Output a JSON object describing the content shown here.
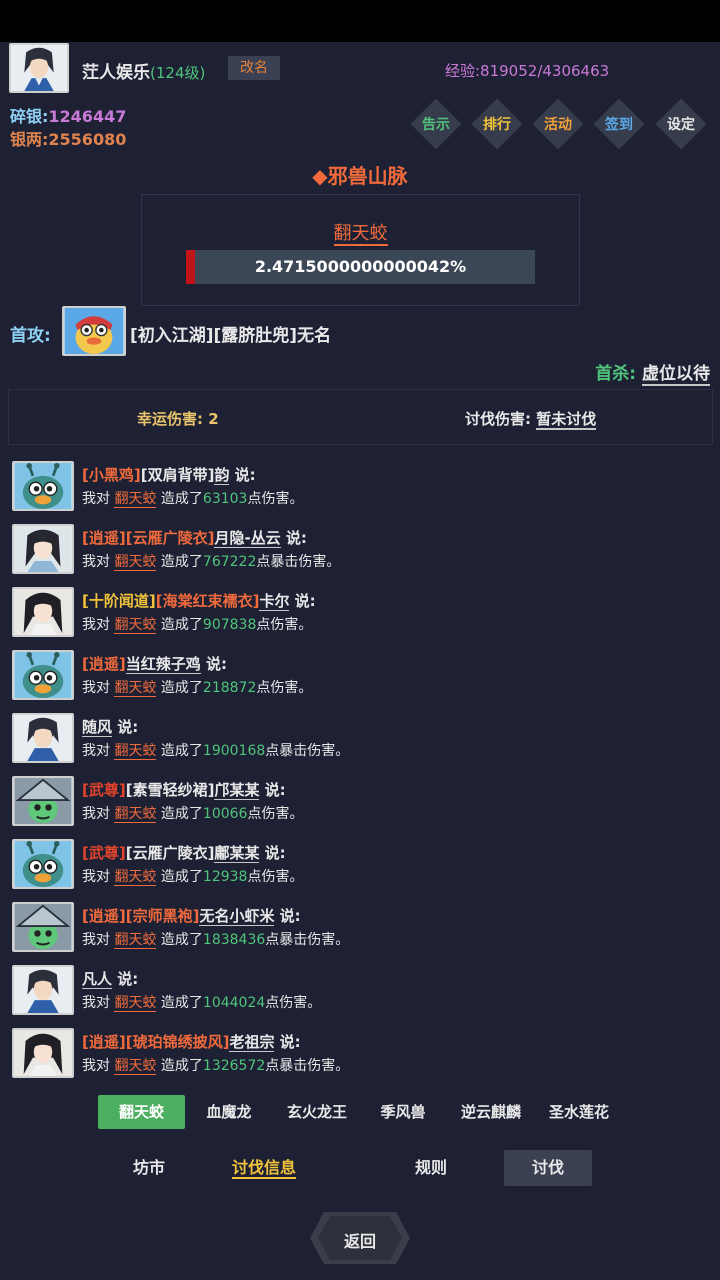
{
  "player": {
    "name": "茳人娱乐",
    "level": "(124级)",
    "rename_label": "改名",
    "exp": "经验:819052/4306463",
    "currency1_label": "碎银:",
    "currency1_value": "1246447",
    "currency2_label": "银两:",
    "currency2_value": "2556080"
  },
  "menu": [
    {
      "label": "告示",
      "color": "#4fc47a"
    },
    {
      "label": "排行",
      "color": "#f0c33a"
    },
    {
      "label": "活动",
      "color": "#f0a23a"
    },
    {
      "label": "签到",
      "color": "#5aa8e6"
    },
    {
      "label": "设定",
      "color": "#e8e8e8"
    }
  ],
  "area": {
    "title": "◆邪兽山脉"
  },
  "boss": {
    "name": "翻天蛟",
    "hp_text": "2.4715000000000042%",
    "hp_fraction": 0.024715
  },
  "first_attack": {
    "label": "首攻:",
    "name": "[初入江湖][露脐肚兜]无名"
  },
  "first_kill": {
    "label": "首杀:",
    "value": "虚位以待"
  },
  "damage": {
    "lucky": "幸运伤害: 2",
    "campaign_label": "讨伐伤害: ",
    "campaign_value": "暂未讨伐"
  },
  "messages": [
    {
      "avatar": "bird",
      "tags": [
        {
          "t": "[小黑鸡]",
          "c": "orange"
        },
        {
          "t": "[双肩背带]",
          "c": "white"
        }
      ],
      "speaker": "韵",
      "says": " 说:",
      "pre": "我对 ",
      "boss": "翻天蛟",
      "mid": " 造成了",
      "num": "63103",
      "post": "点伤害。"
    },
    {
      "avatar": "girl",
      "tags": [
        {
          "t": "[逍遥]",
          "c": "orange"
        },
        {
          "t": "[云雁广陵衣]",
          "c": "orange"
        }
      ],
      "speaker": "月隐-丛云",
      "says": " 说:",
      "pre": "我对 ",
      "boss": "翻天蛟",
      "mid": " 造成了",
      "num": "767222",
      "post": "点暴击伤害。"
    },
    {
      "avatar": "girl2",
      "tags": [
        {
          "t": "[十阶闻道]",
          "c": "yellow"
        },
        {
          "t": "[海棠红束襦衣]",
          "c": "orange"
        }
      ],
      "speaker": "卡尔",
      "says": " 说:",
      "pre": "我对 ",
      "boss": "翻天蛟",
      "mid": " 造成了",
      "num": "907838",
      "post": "点伤害。"
    },
    {
      "avatar": "bird",
      "tags": [
        {
          "t": "[逍遥]",
          "c": "orange"
        }
      ],
      "speaker": "当红辣子鸡",
      "says": " 说:",
      "pre": "我对 ",
      "boss": "翻天蛟",
      "mid": " 造成了",
      "num": "218872",
      "post": "点伤害。"
    },
    {
      "avatar": "boy",
      "tags": [],
      "speaker": "随风",
      "says": " 说:",
      "pre": "我对 ",
      "boss": "翻天蛟",
      "mid": " 造成了",
      "num": "1900168",
      "post": "点暴击伤害。"
    },
    {
      "avatar": "zombie",
      "tags": [
        {
          "t": "[武尊]",
          "c": "red"
        },
        {
          "t": "[素雪轻纱裙]",
          "c": "white"
        }
      ],
      "speaker": "邝某某",
      "says": " 说:",
      "pre": "我对 ",
      "boss": "翻天蛟",
      "mid": " 造成了",
      "num": "10066",
      "post": "点伤害。"
    },
    {
      "avatar": "bird",
      "tags": [
        {
          "t": "[武尊]",
          "c": "red"
        },
        {
          "t": "[云雁广陵衣]",
          "c": "white"
        }
      ],
      "speaker": "鄘某某",
      "says": " 说:",
      "pre": "我对 ",
      "boss": "翻天蛟",
      "mid": " 造成了",
      "num": "12938",
      "post": "点伤害。"
    },
    {
      "avatar": "zombie",
      "tags": [
        {
          "t": "[逍遥]",
          "c": "orange"
        },
        {
          "t": "[宗师黑袍]",
          "c": "orange"
        }
      ],
      "speaker": "无名小虾米",
      "says": " 说:",
      "pre": "我对 ",
      "boss": "翻天蛟",
      "mid": " 造成了",
      "num": "1838436",
      "post": "点暴击伤害。"
    },
    {
      "avatar": "boy",
      "tags": [],
      "speaker": "凡人",
      "says": " 说:",
      "pre": "我对 ",
      "boss": "翻天蛟",
      "mid": " 造成了",
      "num": "1044024",
      "post": "点伤害。"
    },
    {
      "avatar": "girl2",
      "tags": [
        {
          "t": "[逍遥]",
          "c": "orange"
        },
        {
          "t": "[琥珀锦绣披风]",
          "c": "orange"
        }
      ],
      "speaker": "老祖宗",
      "says": " 说:",
      "pre": "我对 ",
      "boss": "翻天蛟",
      "mid": " 造成了",
      "num": "1326572",
      "post": "点暴击伤害。"
    }
  ],
  "boss_tabs": [
    "翻天蛟",
    "血魔龙",
    "玄火龙王",
    "季风兽",
    "逆云麒麟",
    "圣水莲花"
  ],
  "bottom_tabs": [
    "坊市",
    "讨伐信息",
    "规则",
    "讨伐"
  ],
  "back_label": "返回"
}
